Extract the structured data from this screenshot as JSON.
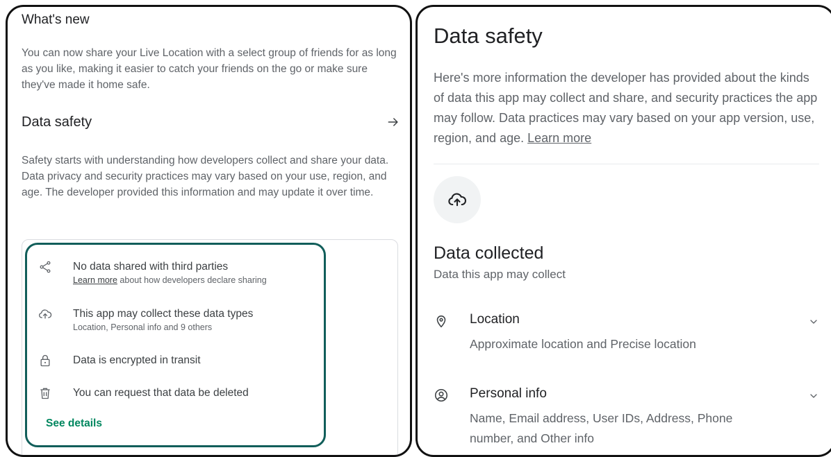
{
  "left": {
    "whats_new": {
      "title": "What's new",
      "body": "You can now share your Live Location with a select group of friends for as long as you like, making it easier to catch your friends on the go or make sure they've made it home safe."
    },
    "data_safety": {
      "title": "Data safety",
      "arrow_icon": "arrow-right-icon",
      "body": "Safety starts with understanding how developers collect and share your data. Data privacy and security practices may vary based on your use, region, and age. The developer provided this information and may update it over time."
    },
    "card": {
      "items": [
        {
          "icon": "share-icon",
          "title": "No data shared with third parties",
          "sub_link": "Learn more",
          "sub_rest": " about how developers declare sharing"
        },
        {
          "icon": "cloud-upload-icon",
          "title": "This app may collect these data types",
          "sub": "Location, Personal info and 9 others"
        },
        {
          "icon": "lock-icon",
          "title": "Data is encrypted in transit"
        },
        {
          "icon": "trash-icon",
          "title": "You can request that data be deleted"
        }
      ],
      "see_details": "See details",
      "accent": "#01875f",
      "highlight_color": "#115e5a"
    }
  },
  "right": {
    "title": "Data safety",
    "body": "Here's more information the developer has provided about the kinds of data this app may collect and share, and security practices the app may follow. Data practices may vary based on your app version, use, region, and age.",
    "learn_more": "Learn more",
    "data_collected": {
      "title": "Data collected",
      "subtitle": "Data this app may collect",
      "items": [
        {
          "icon": "location-pin-icon",
          "name": "Location",
          "desc": "Approximate location and Precise location"
        },
        {
          "icon": "person-circle-icon",
          "name": "Personal info",
          "desc": "Name, Email address, User IDs, Address, Phone number, and Other info"
        }
      ]
    }
  }
}
